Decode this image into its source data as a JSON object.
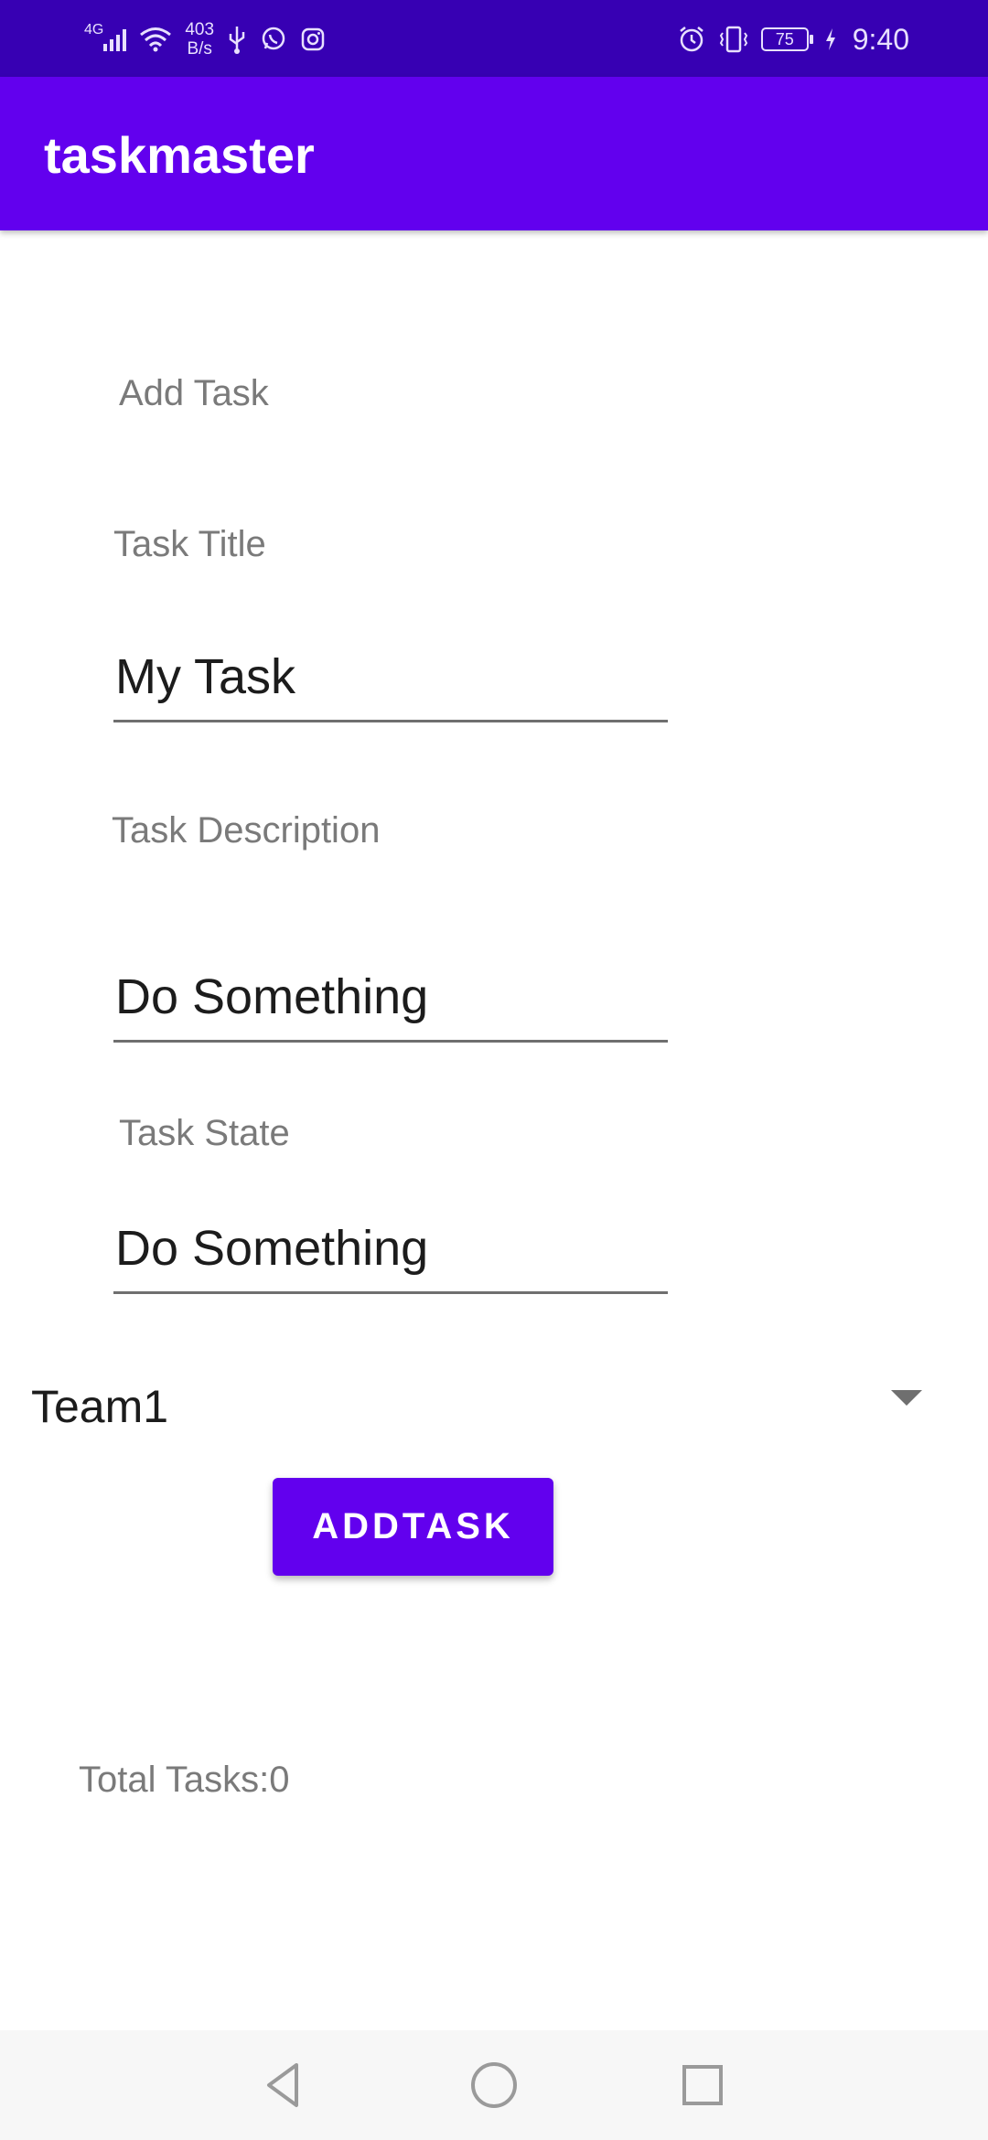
{
  "status_bar": {
    "network_type": "4G",
    "net_speed_value": "403",
    "net_speed_unit": "B/s",
    "battery_level": "75",
    "time": "9:40",
    "icons_left": [
      "signal-icon",
      "wifi-icon",
      "usb-icon",
      "whatsapp-icon",
      "instagram-icon"
    ],
    "icons_right": [
      "alarm-icon",
      "vibrate-icon",
      "battery-icon",
      "charging-icon"
    ]
  },
  "app_bar": {
    "title": "taskmaster"
  },
  "form": {
    "heading": "Add Task",
    "title_label": "Task Title",
    "title_value": "My Task",
    "description_label": "Task Description",
    "description_value": "Do Something",
    "state_label": "Task State",
    "state_value": "Do Something",
    "team_selected": "Team1",
    "submit_label": "ADDTASK"
  },
  "total_tasks": "Total Tasks:0",
  "colors": {
    "status_bar": "#3700B3",
    "primary": "#6200EE",
    "label_gray": "#7a7a7a",
    "text_dark": "#1c1c1c",
    "nav_bar": "#f7f7f7"
  }
}
